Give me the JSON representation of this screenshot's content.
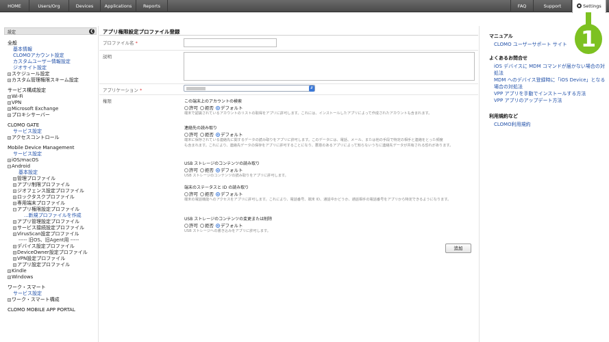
{
  "nav": {
    "items": [
      "HOME",
      "Users/Org",
      "Devices",
      "Applications",
      "Reports"
    ],
    "faq": "FAQ",
    "support": "Support",
    "settings": "Settings"
  },
  "sidebar": {
    "header": "設定",
    "lines": [
      {
        "t": "全般",
        "k": "h"
      },
      {
        "t": "基本情報",
        "k": "link",
        "i": 1
      },
      {
        "t": "CLOMOアカウント設定",
        "k": "link",
        "i": 1
      },
      {
        "t": "カスタムユーザー情報設定",
        "k": "link",
        "i": 1
      },
      {
        "t": "ジオサイト設定",
        "k": "link",
        "i": 1
      },
      {
        "t": "スケジュール設定",
        "k": "plus",
        "i": 1
      },
      {
        "t": "カスタム管理権限スキーム設定",
        "k": "plus",
        "i": 1
      },
      {
        "t": "",
        "k": "gap"
      },
      {
        "t": "サービス構成設定",
        "k": "h"
      },
      {
        "t": "Wi-Fi",
        "k": "plus",
        "i": 1
      },
      {
        "t": "VPN",
        "k": "plus",
        "i": 1
      },
      {
        "t": "Microsoft Exchange",
        "k": "plus",
        "i": 1
      },
      {
        "t": "プロキシサーバー",
        "k": "plus",
        "i": 1
      },
      {
        "t": "",
        "k": "gap"
      },
      {
        "t": "CLOMO GATE",
        "k": "h"
      },
      {
        "t": "サービス設定",
        "k": "link",
        "i": 1
      },
      {
        "t": "アクセスコントロール",
        "k": "plus",
        "i": 1
      },
      {
        "t": "",
        "k": "gap"
      },
      {
        "t": "Mobile Device Management",
        "k": "h"
      },
      {
        "t": "サービス設定",
        "k": "link",
        "i": 1
      },
      {
        "t": "iOS/macOS",
        "k": "plus",
        "i": 1
      },
      {
        "t": "Android",
        "k": "minus",
        "i": 1
      },
      {
        "t": "基本設定",
        "k": "link",
        "i": 2
      },
      {
        "t": "管理プロファイル",
        "k": "plus",
        "i": 2
      },
      {
        "t": "アプリ制限プロファイル",
        "k": "plus",
        "i": 2
      },
      {
        "t": "ジオフェンス設定プロファイル",
        "k": "plus",
        "i": 2
      },
      {
        "t": "ロックタスクプロファイル",
        "k": "plus",
        "i": 2
      },
      {
        "t": "専用端末プロファイル",
        "k": "plus",
        "i": 2
      },
      {
        "t": "アプリ権限設定プロファイル",
        "k": "minus",
        "i": 2
      },
      {
        "t": "...新規プロファイルを作成",
        "k": "link",
        "i": 3
      },
      {
        "t": "アプリ管理設定プロファイル",
        "k": "plus",
        "i": 2
      },
      {
        "t": "サービス接続設定プロファイル",
        "k": "plus",
        "i": 2
      },
      {
        "t": "VirusScan設定プロファイル",
        "k": "plus",
        "i": 2
      },
      {
        "t": "----- 旧OS、旧Agent用 -----",
        "k": "sep",
        "i": 2
      },
      {
        "t": "デバイス設定プロファイル",
        "k": "plus",
        "i": 2
      },
      {
        "t": "DeviceOwner設定プロファイル",
        "k": "plus",
        "i": 2
      },
      {
        "t": "VPN設定プロファイル",
        "k": "plus",
        "i": 2
      },
      {
        "t": "アプリ設定プロファイル",
        "k": "plus",
        "i": 2
      },
      {
        "t": "Kindle",
        "k": "plus",
        "i": 1
      },
      {
        "t": "Windows",
        "k": "plus",
        "i": 1
      },
      {
        "t": "",
        "k": "gap"
      },
      {
        "t": "ワーク・スマート",
        "k": "h"
      },
      {
        "t": "サービス設定",
        "k": "link",
        "i": 1
      },
      {
        "t": "ワーク・スマート構成",
        "k": "plus",
        "i": 1
      },
      {
        "t": "",
        "k": "gap"
      },
      {
        "t": "CLOMO MOBILE APP PORTAL",
        "k": "h"
      }
    ]
  },
  "main": {
    "title": "アプリ権限設定プロファイル登録",
    "labels": {
      "profile_name": "プロファイル名",
      "description": "説明",
      "application": "アプリケーション",
      "permissions": "権限"
    },
    "required_mark": "*",
    "radio_labels": {
      "allow": "許可",
      "deny": "拒否",
      "default": "デフォルト"
    },
    "permissions": [
      {
        "title": "この端末上のアカウントの検索",
        "desc": [
          "端末で認識されているアカウントのリストの取得をアプリに許可します。これには、インストールしたアプリによって作成されたアカウントも含まれます。"
        ]
      },
      {
        "title": "連絡先の読み取り",
        "desc": [
          "端末に保存されている連絡先に関するデータの読み取りをアプリに許可します。このデータには、電話、メール、または他の手段で特定の相手と連絡をとった頻度",
          "も含まれます。これにより、連絡先データの保存をアプリに許可することになり、悪意のあるアプリによって知らないうちに連絡先データが共有される恐れがあります。"
        ]
      },
      {
        "title": "USB ストレージのコンテンツの読み取り",
        "desc": [
          "USB ストレージのコンテンツの読み取りをアプリに許可します。"
        ]
      },
      {
        "title": "端末のステータスと ID の読み取り",
        "desc": [
          "端末の電話機能へのアクセスをアプリに許可します。これにより、電話番号、端末 ID、通話中かどうか、通話相手の電話番号をアプリから特定できるようになります。"
        ]
      },
      {
        "title": "USB ストレージのコンテンツの変更または削除",
        "desc": [
          "USB ストレージへの書き込みをアプリに許可します。"
        ]
      }
    ],
    "add_button": "追加"
  },
  "right": {
    "sections": [
      {
        "heading": "マニュアル",
        "links": [
          "CLOMO ユーザーサポート サイト"
        ]
      },
      {
        "heading": "よくあるお問合せ",
        "links": [
          "iOS デバイスに MDM コマンドが届かない場合の対",
          "処法",
          "MDM へのデバイス登録時に「iOS Device」となる",
          "場合の対処法",
          "VPP アプリを手動でインストールする方法",
          "VPP アプリのアップデート方法"
        ]
      },
      {
        "heading": "利用規約など",
        "links": [
          "CLOMO利用規約"
        ]
      }
    ]
  },
  "callout": {
    "number": "1",
    "color": "#7dc121"
  }
}
